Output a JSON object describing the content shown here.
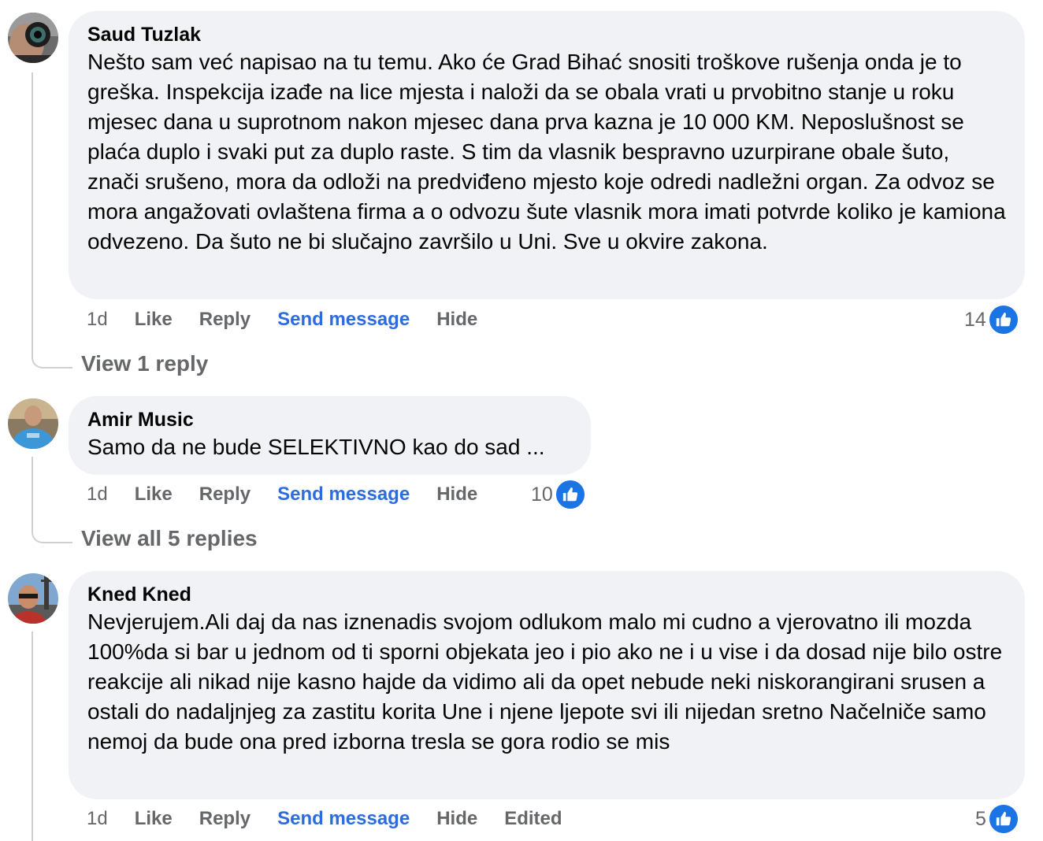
{
  "comments": [
    {
      "author": "Saud Tuzlak",
      "text": "Nešto sam već napisao na tu temu. Ako će Grad Bihać snositi troškove rušenja onda je to greška. Inspekcija izađe na lice mjesta i naloži da se obala vrati u prvobitno stanje u roku mjesec dana u suprotnom nakon mjesec dana prva kazna je 10 000 KM. Neposlušnost se plaća duplo i svaki put za duplo raste. S tim da vlasnik bespravno uzurpirane obale šuto, znači srušeno, mora da odloži na predviđeno mjesto koje odredi nadležni organ. Za odvoz se mora angažovati ovlaštena firma a o odvozu šute vlasnik mora imati potvrde koliko je kamiona odvezeno. Da šuto ne bi slučajno završilo u Uni. Sve u okvire zakona.",
      "time": "1d",
      "like_label": "Like",
      "reply_label": "Reply",
      "send_label": "Send message",
      "hide_label": "Hide",
      "reaction_count": "14",
      "view_replies": "View 1 reply"
    },
    {
      "author": "Amir Music",
      "text": "Samo da ne bude SELEKTIVNO kao do sad ...",
      "time": "1d",
      "like_label": "Like",
      "reply_label": "Reply",
      "send_label": "Send message",
      "hide_label": "Hide",
      "reaction_count": "10",
      "view_replies": "View all 5 replies"
    },
    {
      "author": "Kned Kned",
      "text": "Nevjerujem.Ali daj da nas iznenadis svojom odlukom malo mi cudno a vjerovatno ili mozda 100%da si bar u jednom od ti sporni objekata jeo i pio ako ne i u vise i da dosad nije bilo ostre reakcije ali nikad nije kasno hajde da vidimo ali da opet nebude neki niskorangirani srusen a ostali do nadaljnjeg za zastitu korita Une i njene ljepote svi ili nijedan sretno Načelniče samo nemoj da bude ona pred izborna tresla se gora rodio se mis",
      "time": "1d",
      "like_label": "Like",
      "reply_label": "Reply",
      "send_label": "Send message",
      "hide_label": "Hide",
      "edited_label": "Edited",
      "reaction_count": "5"
    }
  ],
  "colors": {
    "bubble_bg": "#f0f2f5",
    "meta_text": "#65676b",
    "link_blue": "#2d6cdf",
    "like_blue": "#1b74e4"
  },
  "icons": [
    "avatar-photo",
    "like-thumb-icon"
  ]
}
